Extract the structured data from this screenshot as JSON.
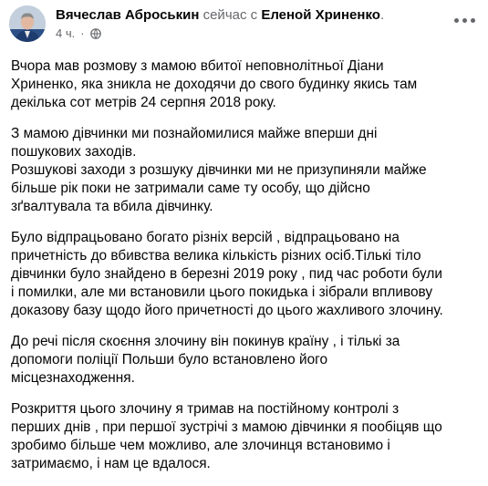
{
  "post": {
    "author": "Вячеслав Аброськин",
    "connector": "сейчас с",
    "tagged": "Еленой Хриненко",
    "period": ".",
    "time": "4 ч.",
    "separator": "·",
    "privacy_icon": "globe-icon",
    "menu_icon": "more-options-icon",
    "paragraphs": [
      "Вчора мав розмову з мамою вбитої неповнолітньої Діани\nХриненко, яка зникла не доходячи до свого будинку якись там\nдекілька сот метрів 24 серпня 2018 року.",
      "З мамою дівчинки ми познайомилися майже вперши дні\nпошукових заходів.\nРозшукові заходи з розшуку  дівчинки ми не призупиняли  майже\nбільше рік поки не затримали саме ту особу, що дійсно\nзґвалтувала та вбила дівчинку.",
      "Було  відпрацьовано богато різніх версій ,  відпрацьовано на\nпричетність до вбивства  велика кількість різних осіб.Тількі тіло\nдівчинки було знайдено в березні 2019 року ,  пид час роботи були\nі помилки,  але ми встановили цього покидька і зібрали впливову\nдоказову базу щодо його причетності до цього жахливого злочину.",
      "До речі після скоєння злочину він покинув країну , і тількі за\nдопомоги поліції Польши було встановлено його\nмісцезнаходження.",
      "Розкриття цього злочину я тримав на постійному контролі з\nперших днів , при першої зустрічі з мамою дівчинки я пообіцяв що\nзробимо більше чем можливо, але злочинця встановимо і\nзатримаємо, і нам це вдалося."
    ]
  }
}
